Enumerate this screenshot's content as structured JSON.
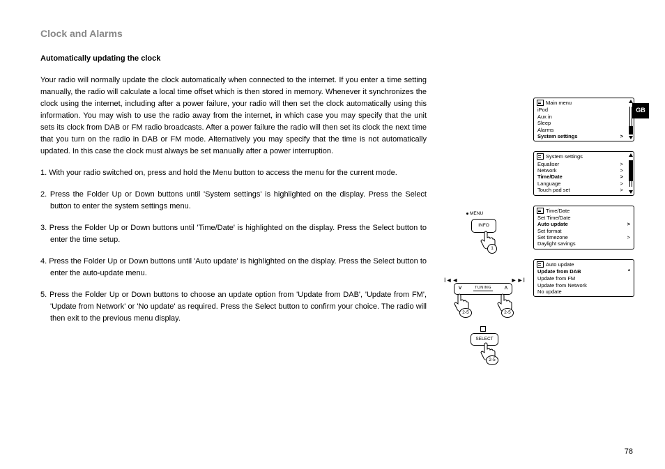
{
  "header": {
    "title": "Clock and Alarms",
    "pageNumber": "78",
    "langBadge": "GB"
  },
  "section": {
    "heading": "Automatically updating the clock"
  },
  "paragraphs": {
    "intro": "Your radio will normally update the clock automatically when connected to the internet. If you enter a time setting manually, the radio will calculate a local time offset which is then stored in memory. Whenever it synchronizes the clock using the internet, including after a power failure, your radio will then set the clock automatically using this information. You may wish to use the radio away from the internet, in which case you may specify that the unit sets its clock from DAB or FM radio broadcasts. After a power failure the radio will then set its clock the next time that you turn on the radio in DAB or FM mode. Alternatively you may specify that the time is not automatically updated. In this case the clock must always be set manually after a power interruption."
  },
  "steps": {
    "1": "1. With your radio switched on, press and hold the Menu button to access the menu for the current mode.",
    "2": "2. Press the Folder Up or Down buttons until 'System settings' is highlighted on the display. Press the Select button to enter the system settings menu.",
    "3": "3. Press the Folder Up or Down buttons until 'Time/Date' is highlighted on the display. Press the Select button to enter the time setup.",
    "4": "4. Press the Folder Up or Down buttons until 'Auto update' is highlighted on the display. Press the Select button to enter the auto-update menu.",
    "5": "5. Press the Folder Up or Down buttons to choose an update option from 'Update from DAB', 'Update from FM', 'Update from Network' or 'No update' as required. Press the Select button to confirm your choice. The radio will then exit to the previous menu display."
  },
  "diagram": {
    "menuLabel": "MENU",
    "infoLabel": "INFO",
    "tuningLabel": "TUNING",
    "selectLabel": "SELECT",
    "step1": "1",
    "step25": "2-5",
    "skipBack": "I◄◄",
    "skipFwd": "►►I",
    "down": "ᐯ",
    "up": "ᐱ",
    "stop": "■"
  },
  "screens": {
    "main": {
      "title": "Main menu",
      "r1": "iPod",
      "r2": "Aux in",
      "r3": "Sleep",
      "r4": "Alarms",
      "r5": "System settings",
      "m5": ">"
    },
    "sys": {
      "title": "System settings",
      "r1": "Equaliser",
      "m1": ">",
      "r2": "Network",
      "m2": ">",
      "r3": "Time/Date",
      "m3": ">",
      "r4": "Language",
      "m4": ">",
      "r5": "Touch pad set",
      "m5": ">"
    },
    "time": {
      "title": "Time/Date",
      "r1": "Set Time/Date",
      "r2": "Auto update",
      "m2": ">",
      "r3": "Set format",
      "r4": "Set timezone",
      "m4": ">",
      "r5": "Daylight savings"
    },
    "auto": {
      "title": "Auto update",
      "r1": "Update from DAB",
      "m1": "*",
      "r2": "Update from FM",
      "r3": "Update from Network",
      "r4": "No update"
    }
  }
}
